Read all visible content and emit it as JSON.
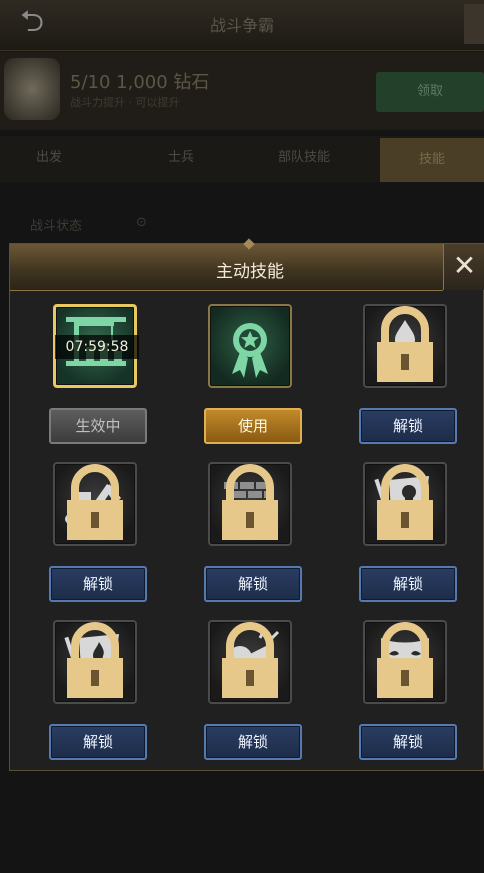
{
  "background": {
    "back_icon": "back-arrow-icon",
    "title": "战斗争霸",
    "row_title": "5/10 1,000 钻石",
    "row_subtitle": "战斗力提升 · 可以提升",
    "green_button": "领取",
    "tabs": [
      "出发",
      "士兵",
      "部队技能",
      "技能"
    ],
    "sub_left": "战斗状态",
    "sub_right": "⊙"
  },
  "popup": {
    "title": "主动技能",
    "close_icon": "close-x-icon",
    "close_label": "✕"
  },
  "skills": [
    {
      "icon": "crane-construction-icon",
      "locked": false,
      "state": "active",
      "timer": "07:59:58",
      "button": "生效中"
    },
    {
      "icon": "ribbon-medal-icon",
      "locked": false,
      "state": "ready",
      "timer": "",
      "button": "使用"
    },
    {
      "icon": "hands-water-drop-icon",
      "locked": true,
      "state": "locked",
      "timer": "",
      "button": "解锁"
    },
    {
      "icon": "excavator-icon",
      "locked": true,
      "state": "locked",
      "timer": "",
      "button": "解锁"
    },
    {
      "icon": "brick-wall-shell-icon",
      "locked": true,
      "state": "locked",
      "timer": "",
      "button": "解锁"
    },
    {
      "icon": "skull-flag-icon",
      "locked": true,
      "state": "locked",
      "timer": "",
      "button": "解锁"
    },
    {
      "icon": "fire-flag-icon",
      "locked": true,
      "state": "locked",
      "timer": "",
      "button": "解锁"
    },
    {
      "icon": "shouting-man-icon",
      "locked": true,
      "state": "locked",
      "timer": "",
      "button": "解锁"
    },
    {
      "icon": "theater-mask-icon",
      "locked": true,
      "state": "locked",
      "timer": "",
      "button": "解锁"
    }
  ],
  "colors": {
    "accent_gold": "#e8c860",
    "unlock_blue": "#557ab0",
    "use_orange": "#c18a2a",
    "active_gray": "#5e5e5e"
  }
}
